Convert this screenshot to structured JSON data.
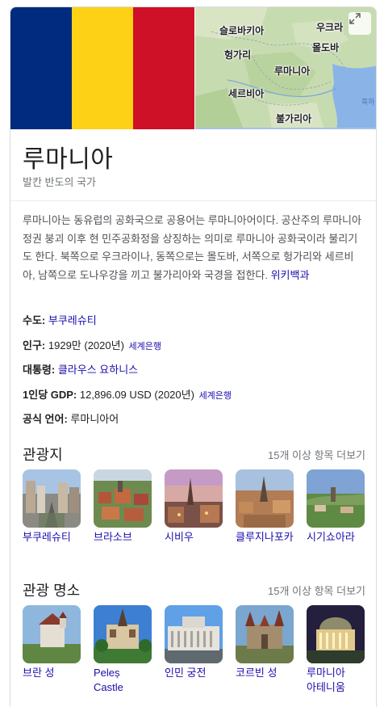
{
  "hero": {
    "flag_colors": [
      "#002b7f",
      "#fcd116",
      "#ce1126"
    ],
    "map_labels": {
      "slovakia": "슬로바키아",
      "ukraine": "우크라",
      "hungary": "헝가리",
      "moldova": "몰도바",
      "romania": "루마니아",
      "serbia": "세르비아",
      "bulgaria": "불가리아",
      "black_sea": "흑하"
    },
    "expand_icon": "expand-icon"
  },
  "entity": {
    "title": "루마니아",
    "subtitle": "발칸 반도의 국가"
  },
  "description": {
    "text": "루마니아는 동유럽의 공화국으로 공용어는 루마니아어이다. 공산주의 루마니아 정권 붕괴 이후 현 민주공화정을 상징하는 의미로 루마니아 공화국이라 불리기도 한다. 북쪽으로 우크라이나, 동쪽으로는 몰도바, 서쪽으로 헝가리와 세르비아, 남쪽으로 도나우강을 끼고 불가리아와 국경을 접한다. ",
    "source_link": "위키백과"
  },
  "facts": {
    "capital_label": "수도:",
    "capital_value": "부쿠레슈티",
    "population_label": "인구:",
    "population_value": "1929만 (2020년)",
    "population_source": "세계은행",
    "president_label": "대통령:",
    "president_value": "클라우스 요하니스",
    "gdp_label": "1인당 GDP:",
    "gdp_value": "12,896.09 USD (2020년)",
    "gdp_source": "세계은행",
    "language_label": "공식 언어:",
    "language_value": "루마니아어"
  },
  "tourist_cities": {
    "title": "관광지",
    "more": "15개 이상 항목 더보기",
    "items": [
      {
        "label": "부쿠레슈티"
      },
      {
        "label": "브라소브"
      },
      {
        "label": "시비우"
      },
      {
        "label": "클루지나포카"
      },
      {
        "label": "시기쇼아라"
      }
    ]
  },
  "attractions": {
    "title": "관광 명소",
    "more": "15개 이상 항목 더보기",
    "items": [
      {
        "label": "브란 성"
      },
      {
        "label": "Peleș Castle"
      },
      {
        "label": "인민 궁전"
      },
      {
        "label": "코르빈 성"
      },
      {
        "label": "루마니아 아테니움"
      }
    ]
  }
}
